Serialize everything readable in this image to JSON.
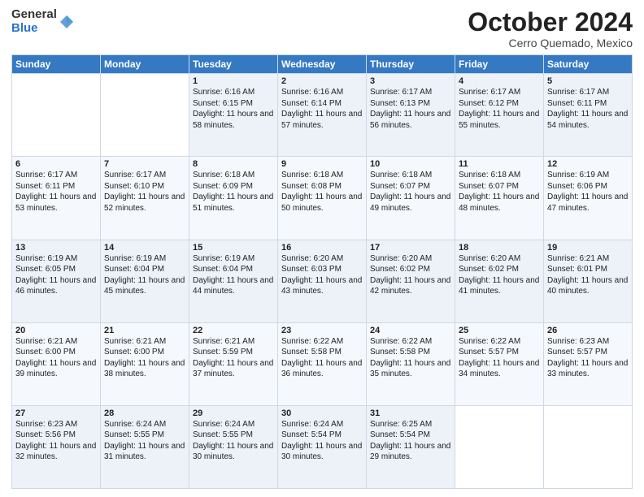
{
  "header": {
    "logo_general": "General",
    "logo_blue": "Blue",
    "month_title": "October 2024",
    "location": "Cerro Quemado, Mexico"
  },
  "days_of_week": [
    "Sunday",
    "Monday",
    "Tuesday",
    "Wednesday",
    "Thursday",
    "Friday",
    "Saturday"
  ],
  "weeks": [
    [
      {
        "day": "",
        "sunrise": "",
        "sunset": "",
        "daylight": ""
      },
      {
        "day": "",
        "sunrise": "",
        "sunset": "",
        "daylight": ""
      },
      {
        "day": "1",
        "sunrise": "Sunrise: 6:16 AM",
        "sunset": "Sunset: 6:15 PM",
        "daylight": "Daylight: 11 hours and 58 minutes."
      },
      {
        "day": "2",
        "sunrise": "Sunrise: 6:16 AM",
        "sunset": "Sunset: 6:14 PM",
        "daylight": "Daylight: 11 hours and 57 minutes."
      },
      {
        "day": "3",
        "sunrise": "Sunrise: 6:17 AM",
        "sunset": "Sunset: 6:13 PM",
        "daylight": "Daylight: 11 hours and 56 minutes."
      },
      {
        "day": "4",
        "sunrise": "Sunrise: 6:17 AM",
        "sunset": "Sunset: 6:12 PM",
        "daylight": "Daylight: 11 hours and 55 minutes."
      },
      {
        "day": "5",
        "sunrise": "Sunrise: 6:17 AM",
        "sunset": "Sunset: 6:11 PM",
        "daylight": "Daylight: 11 hours and 54 minutes."
      }
    ],
    [
      {
        "day": "6",
        "sunrise": "Sunrise: 6:17 AM",
        "sunset": "Sunset: 6:11 PM",
        "daylight": "Daylight: 11 hours and 53 minutes."
      },
      {
        "day": "7",
        "sunrise": "Sunrise: 6:17 AM",
        "sunset": "Sunset: 6:10 PM",
        "daylight": "Daylight: 11 hours and 52 minutes."
      },
      {
        "day": "8",
        "sunrise": "Sunrise: 6:18 AM",
        "sunset": "Sunset: 6:09 PM",
        "daylight": "Daylight: 11 hours and 51 minutes."
      },
      {
        "day": "9",
        "sunrise": "Sunrise: 6:18 AM",
        "sunset": "Sunset: 6:08 PM",
        "daylight": "Daylight: 11 hours and 50 minutes."
      },
      {
        "day": "10",
        "sunrise": "Sunrise: 6:18 AM",
        "sunset": "Sunset: 6:07 PM",
        "daylight": "Daylight: 11 hours and 49 minutes."
      },
      {
        "day": "11",
        "sunrise": "Sunrise: 6:18 AM",
        "sunset": "Sunset: 6:07 PM",
        "daylight": "Daylight: 11 hours and 48 minutes."
      },
      {
        "day": "12",
        "sunrise": "Sunrise: 6:19 AM",
        "sunset": "Sunset: 6:06 PM",
        "daylight": "Daylight: 11 hours and 47 minutes."
      }
    ],
    [
      {
        "day": "13",
        "sunrise": "Sunrise: 6:19 AM",
        "sunset": "Sunset: 6:05 PM",
        "daylight": "Daylight: 11 hours and 46 minutes."
      },
      {
        "day": "14",
        "sunrise": "Sunrise: 6:19 AM",
        "sunset": "Sunset: 6:04 PM",
        "daylight": "Daylight: 11 hours and 45 minutes."
      },
      {
        "day": "15",
        "sunrise": "Sunrise: 6:19 AM",
        "sunset": "Sunset: 6:04 PM",
        "daylight": "Daylight: 11 hours and 44 minutes."
      },
      {
        "day": "16",
        "sunrise": "Sunrise: 6:20 AM",
        "sunset": "Sunset: 6:03 PM",
        "daylight": "Daylight: 11 hours and 43 minutes."
      },
      {
        "day": "17",
        "sunrise": "Sunrise: 6:20 AM",
        "sunset": "Sunset: 6:02 PM",
        "daylight": "Daylight: 11 hours and 42 minutes."
      },
      {
        "day": "18",
        "sunrise": "Sunrise: 6:20 AM",
        "sunset": "Sunset: 6:02 PM",
        "daylight": "Daylight: 11 hours and 41 minutes."
      },
      {
        "day": "19",
        "sunrise": "Sunrise: 6:21 AM",
        "sunset": "Sunset: 6:01 PM",
        "daylight": "Daylight: 11 hours and 40 minutes."
      }
    ],
    [
      {
        "day": "20",
        "sunrise": "Sunrise: 6:21 AM",
        "sunset": "Sunset: 6:00 PM",
        "daylight": "Daylight: 11 hours and 39 minutes."
      },
      {
        "day": "21",
        "sunrise": "Sunrise: 6:21 AM",
        "sunset": "Sunset: 6:00 PM",
        "daylight": "Daylight: 11 hours and 38 minutes."
      },
      {
        "day": "22",
        "sunrise": "Sunrise: 6:21 AM",
        "sunset": "Sunset: 5:59 PM",
        "daylight": "Daylight: 11 hours and 37 minutes."
      },
      {
        "day": "23",
        "sunrise": "Sunrise: 6:22 AM",
        "sunset": "Sunset: 5:58 PM",
        "daylight": "Daylight: 11 hours and 36 minutes."
      },
      {
        "day": "24",
        "sunrise": "Sunrise: 6:22 AM",
        "sunset": "Sunset: 5:58 PM",
        "daylight": "Daylight: 11 hours and 35 minutes."
      },
      {
        "day": "25",
        "sunrise": "Sunrise: 6:22 AM",
        "sunset": "Sunset: 5:57 PM",
        "daylight": "Daylight: 11 hours and 34 minutes."
      },
      {
        "day": "26",
        "sunrise": "Sunrise: 6:23 AM",
        "sunset": "Sunset: 5:57 PM",
        "daylight": "Daylight: 11 hours and 33 minutes."
      }
    ],
    [
      {
        "day": "27",
        "sunrise": "Sunrise: 6:23 AM",
        "sunset": "Sunset: 5:56 PM",
        "daylight": "Daylight: 11 hours and 32 minutes."
      },
      {
        "day": "28",
        "sunrise": "Sunrise: 6:24 AM",
        "sunset": "Sunset: 5:55 PM",
        "daylight": "Daylight: 11 hours and 31 minutes."
      },
      {
        "day": "29",
        "sunrise": "Sunrise: 6:24 AM",
        "sunset": "Sunset: 5:55 PM",
        "daylight": "Daylight: 11 hours and 30 minutes."
      },
      {
        "day": "30",
        "sunrise": "Sunrise: 6:24 AM",
        "sunset": "Sunset: 5:54 PM",
        "daylight": "Daylight: 11 hours and 30 minutes."
      },
      {
        "day": "31",
        "sunrise": "Sunrise: 6:25 AM",
        "sunset": "Sunset: 5:54 PM",
        "daylight": "Daylight: 11 hours and 29 minutes."
      },
      {
        "day": "",
        "sunrise": "",
        "sunset": "",
        "daylight": ""
      },
      {
        "day": "",
        "sunrise": "",
        "sunset": "",
        "daylight": ""
      }
    ]
  ]
}
